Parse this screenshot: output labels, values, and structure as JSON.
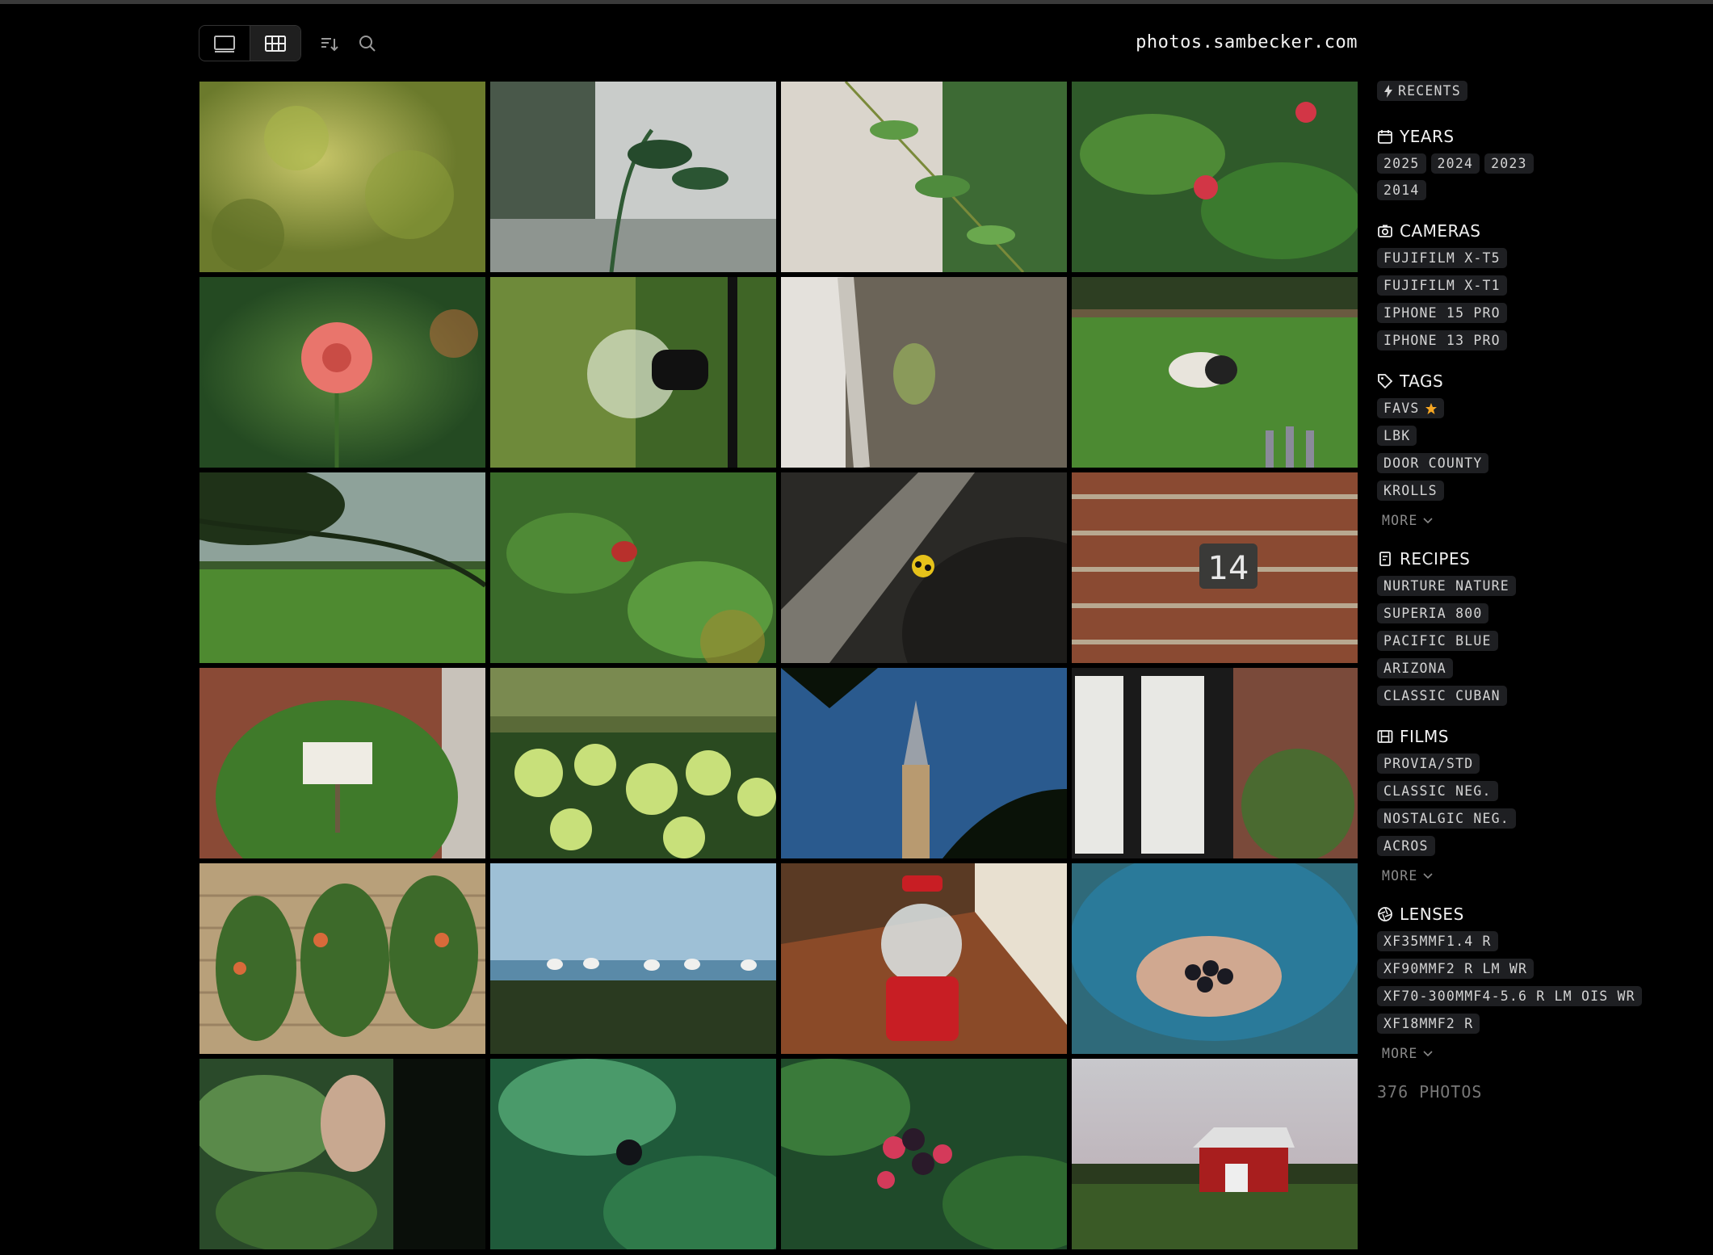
{
  "site": {
    "title": "photos.sambecker.com"
  },
  "toolbar": {
    "view_full_icon": "single-view-icon",
    "view_grid_icon": "grid-view-icon",
    "sort_icon": "sort-icon",
    "search_icon": "search-icon"
  },
  "sidebar": {
    "recents": "RECENTS",
    "years": {
      "heading": "YEARS",
      "items": [
        "2025",
        "2024",
        "2023",
        "2014"
      ]
    },
    "cameras": {
      "heading": "CAMERAS",
      "items": [
        "FUJIFILM X-T5",
        "FUJIFILM X-T1",
        "IPHONE 15 PRO",
        "IPHONE 13 PRO"
      ]
    },
    "tags": {
      "heading": "TAGS",
      "items": [
        "FAVS",
        "LBK",
        "DOOR COUNTY",
        "KROLLS"
      ],
      "more": "MORE"
    },
    "recipes": {
      "heading": "RECIPES",
      "items": [
        "NURTURE NATURE",
        "SUPERIA 800",
        "PACIFIC BLUE",
        "ARIZONA",
        "CLASSIC CUBAN"
      ]
    },
    "films": {
      "heading": "FILMS",
      "items": [
        "PROVIA/STD",
        "CLASSIC NEG.",
        "NOSTALGIC NEG.",
        "ACROS"
      ],
      "more": "MORE"
    },
    "lenses": {
      "heading": "LENSES",
      "items": [
        "XF35MMF1.4 R",
        "XF90MMF2 R LM WR",
        "XF70-300MMF4-5.6 R LM OIS WR",
        "XF18MMF2 R"
      ],
      "more": "MORE"
    },
    "count": "376 PHOTOS"
  },
  "colors": {
    "background": "#000000",
    "chip": "#1e1f22",
    "star": "#f5a623"
  }
}
